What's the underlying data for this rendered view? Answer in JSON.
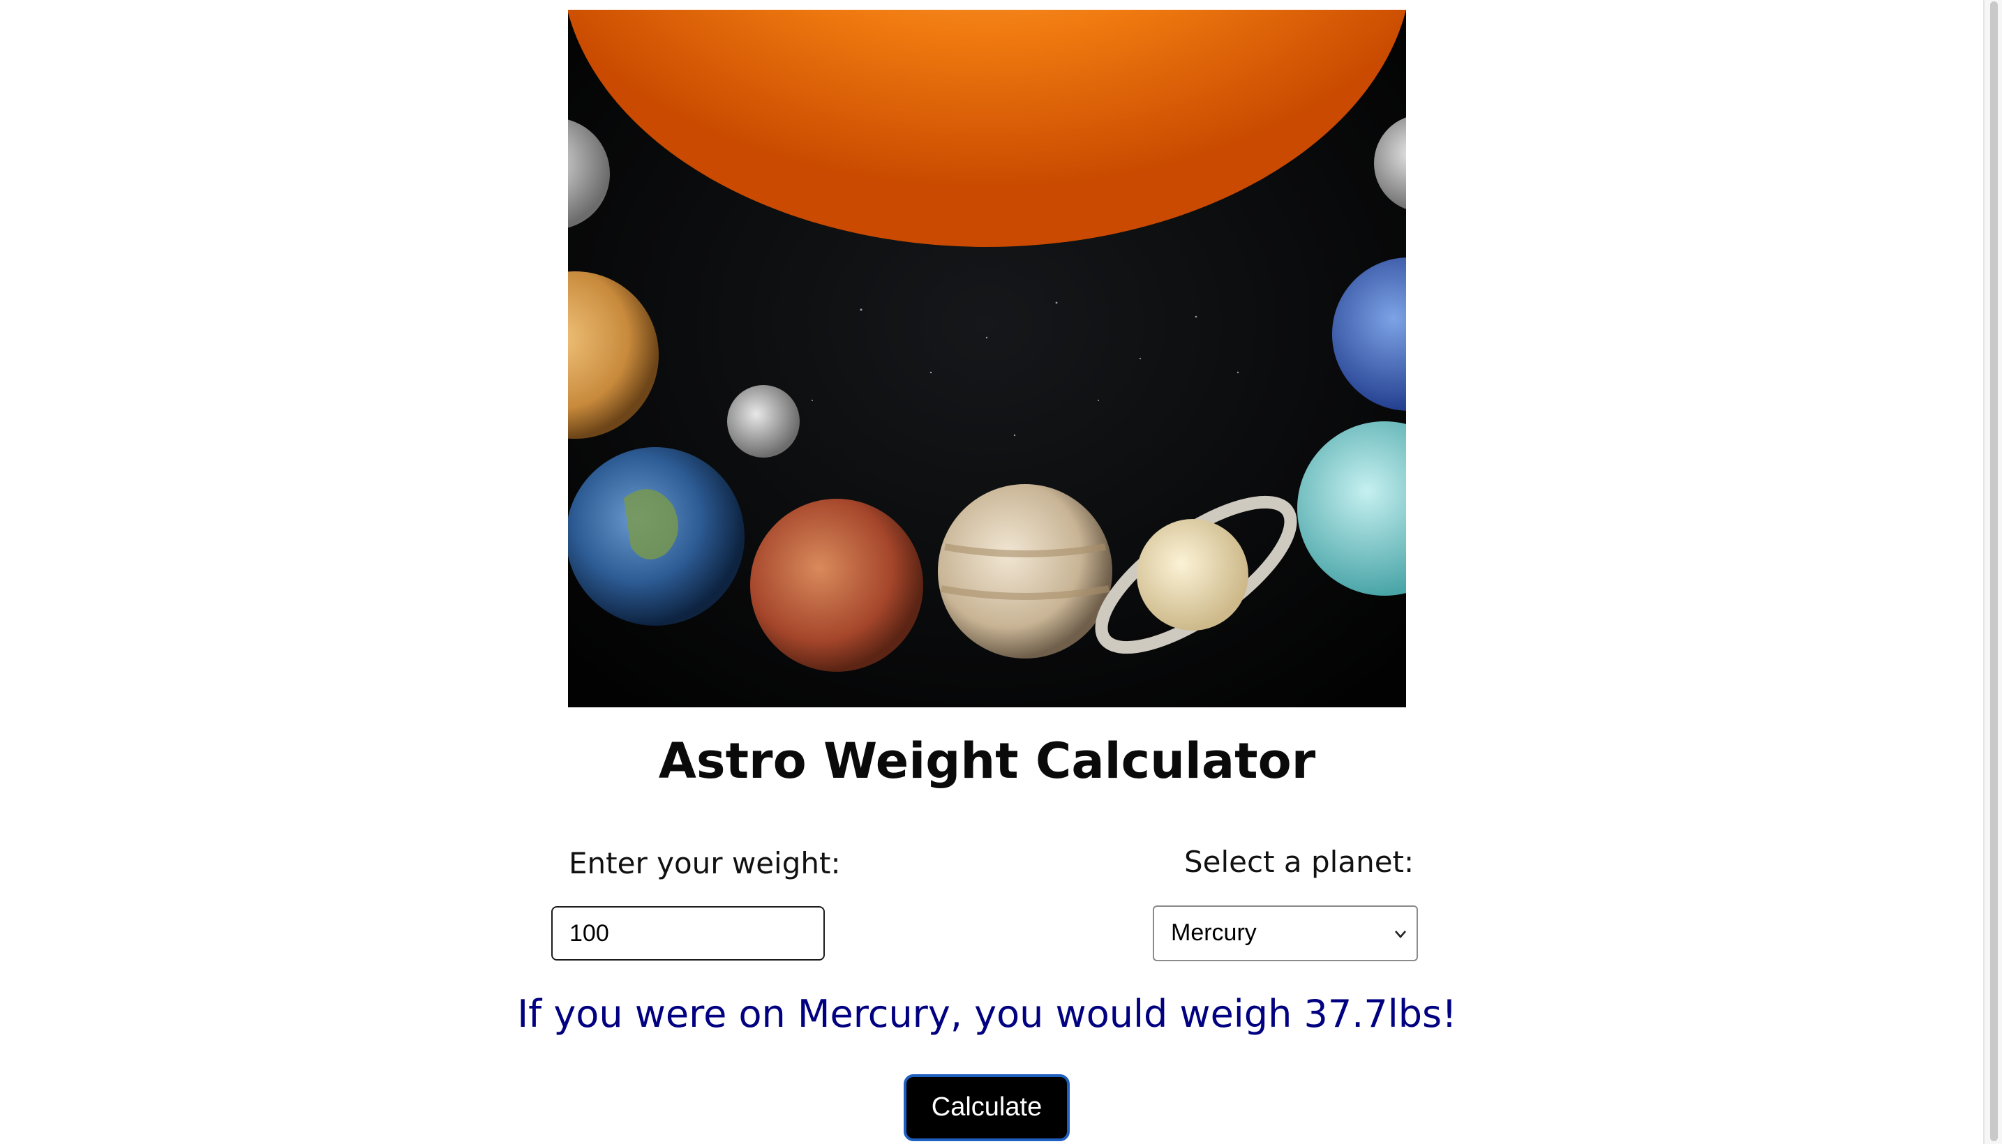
{
  "title": "Astro Weight Calculator",
  "weight": {
    "label": "Enter your weight:",
    "value": "100"
  },
  "planet": {
    "label": "Select a planet:",
    "selected": "Mercury"
  },
  "result": "If you were on Mercury, you would weigh 37.7lbs!",
  "calculate_label": "Calculate",
  "colors": {
    "result_text": "#000080",
    "button_bg": "#000000",
    "button_border": "#1f5fbf"
  }
}
